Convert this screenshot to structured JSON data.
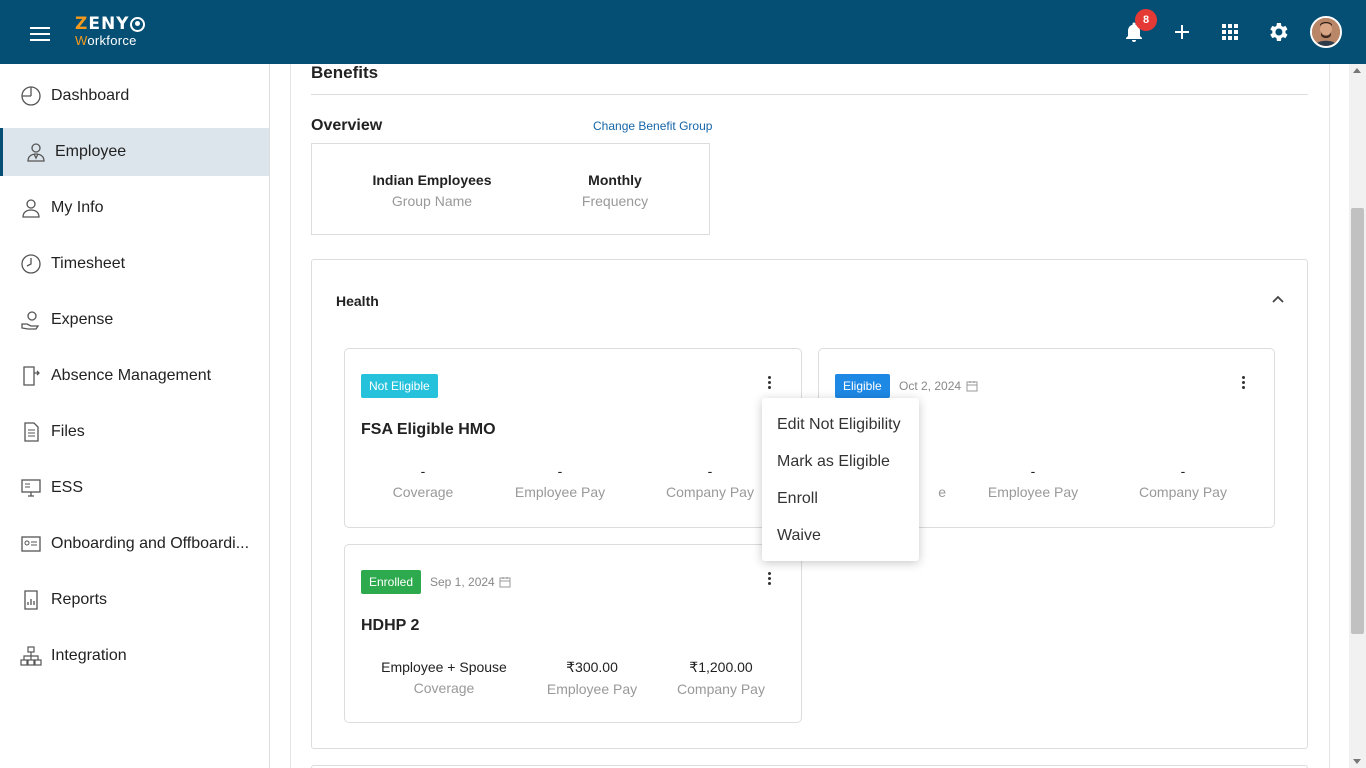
{
  "header": {
    "logo_top": "ZENY",
    "logo_bottom": "Workforce",
    "notification_count": "8",
    "colors": {
      "bar": "#054f74",
      "accent": "#f39a1d",
      "badge": "#e53935"
    },
    "icons": [
      "menu-icon",
      "bell-icon",
      "plus-icon",
      "apps-grid-icon",
      "gear-icon",
      "avatar"
    ]
  },
  "sidebar": {
    "items": [
      {
        "label": "Dashboard",
        "icon": "dashboard-icon"
      },
      {
        "label": "Employee",
        "icon": "employee-icon",
        "active": true
      },
      {
        "label": "My Info",
        "icon": "user-icon"
      },
      {
        "label": "Timesheet",
        "icon": "clock-icon"
      },
      {
        "label": "Expense",
        "icon": "expense-icon"
      },
      {
        "label": "Absence Management",
        "icon": "door-icon"
      },
      {
        "label": "Files",
        "icon": "file-icon"
      },
      {
        "label": "ESS",
        "icon": "ess-icon"
      },
      {
        "label": "Onboarding and Offboardi...",
        "icon": "id-card-icon"
      },
      {
        "label": "Reports",
        "icon": "report-icon"
      },
      {
        "label": "Integration",
        "icon": "hierarchy-icon"
      }
    ]
  },
  "main": {
    "title": "Benefits",
    "overview": {
      "label": "Overview",
      "change_link": "Change Benefit Group",
      "group_value": "Indian Employees",
      "group_label": "Group Name",
      "frequency_value": "Monthly",
      "frequency_label": "Frequency"
    },
    "health": {
      "title": "Health",
      "cards": [
        {
          "status": "Not Eligible",
          "date": "",
          "plan": "FSA Eligible HMO",
          "coverage": "-",
          "coverage_label": "Coverage",
          "employee_pay": "-",
          "employee_pay_label": "Employee Pay",
          "company_pay": "-",
          "company_pay_label": "Company Pay"
        },
        {
          "status": "Eligible",
          "date": "Oct 2, 2024",
          "plan": "",
          "coverage": "-",
          "coverage_label": "e",
          "employee_pay": "-",
          "employee_pay_label": "Employee Pay",
          "company_pay": "-",
          "company_pay_label": "Company Pay"
        },
        {
          "status": "Enrolled",
          "date": "Sep 1, 2024",
          "plan": "HDHP 2",
          "coverage": "Employee + Spouse",
          "coverage_label": "Coverage",
          "employee_pay": "₹300.00",
          "employee_pay_label": "Employee Pay",
          "company_pay": "₹1,200.00",
          "company_pay_label": "Company Pay"
        }
      ]
    },
    "context_menu": {
      "items": [
        "Edit Not Eligibility",
        "Mark as Eligible",
        "Enroll",
        "Waive"
      ]
    }
  }
}
